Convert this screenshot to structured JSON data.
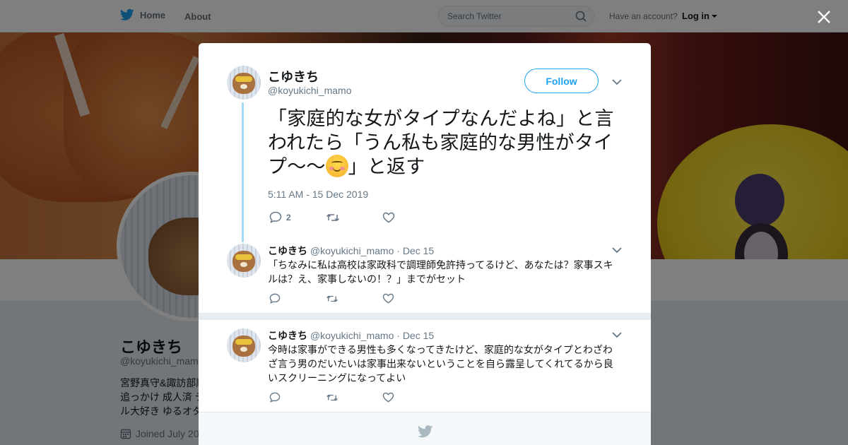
{
  "topbar": {
    "home_label": "Home",
    "about_label": "About",
    "search_placeholder": "Search Twitter",
    "account_prompt": "Have an account?",
    "login_label": "Log in",
    "brand_color": "#1da1f2"
  },
  "profile": {
    "name": "こゆきち",
    "handle": "@koyukichi_mamo",
    "bio_lines": [
      "宮野真守&諏訪部順",
      "追っかけ 成人済 テ",
      "ル大好き ゆるオタク"
    ],
    "joined": "Joined July 20"
  },
  "modal": {
    "main_tweet": {
      "name": "こゆきち",
      "handle": "@koyukichi_mamo",
      "follow_label": "Follow",
      "text_before_emoji": "「家庭的な女がタイプなんだよね」と言われたら「うん私も家庭的な男性がタイプ～～",
      "emoji_icon": "smiling-face-with-smiling-eyes-icon",
      "text_after_emoji": "」と返す",
      "timestamp": "5:11 AM - 15 Dec 2019",
      "reply_count": "2"
    },
    "replies": [
      {
        "name": "こゆきち",
        "handle": "@koyukichi_mamo",
        "sep": "·",
        "date": "Dec 15",
        "text": "「ちなみに私は高校は家政科で調理師免許持ってるけど、あなたは？家事スキルは？え、家事しないの！？」までがセット"
      },
      {
        "name": "こゆきち",
        "handle": "@koyukichi_mamo",
        "sep": "·",
        "date": "Dec 15",
        "text": "今時は家事ができる男性も多くなってきたけど、家庭的な女がタイプとわざわざ言う男のだいたいは家事出来ないということを自ら露呈してくれてるから良いスクリーニングになってよい"
      }
    ]
  }
}
